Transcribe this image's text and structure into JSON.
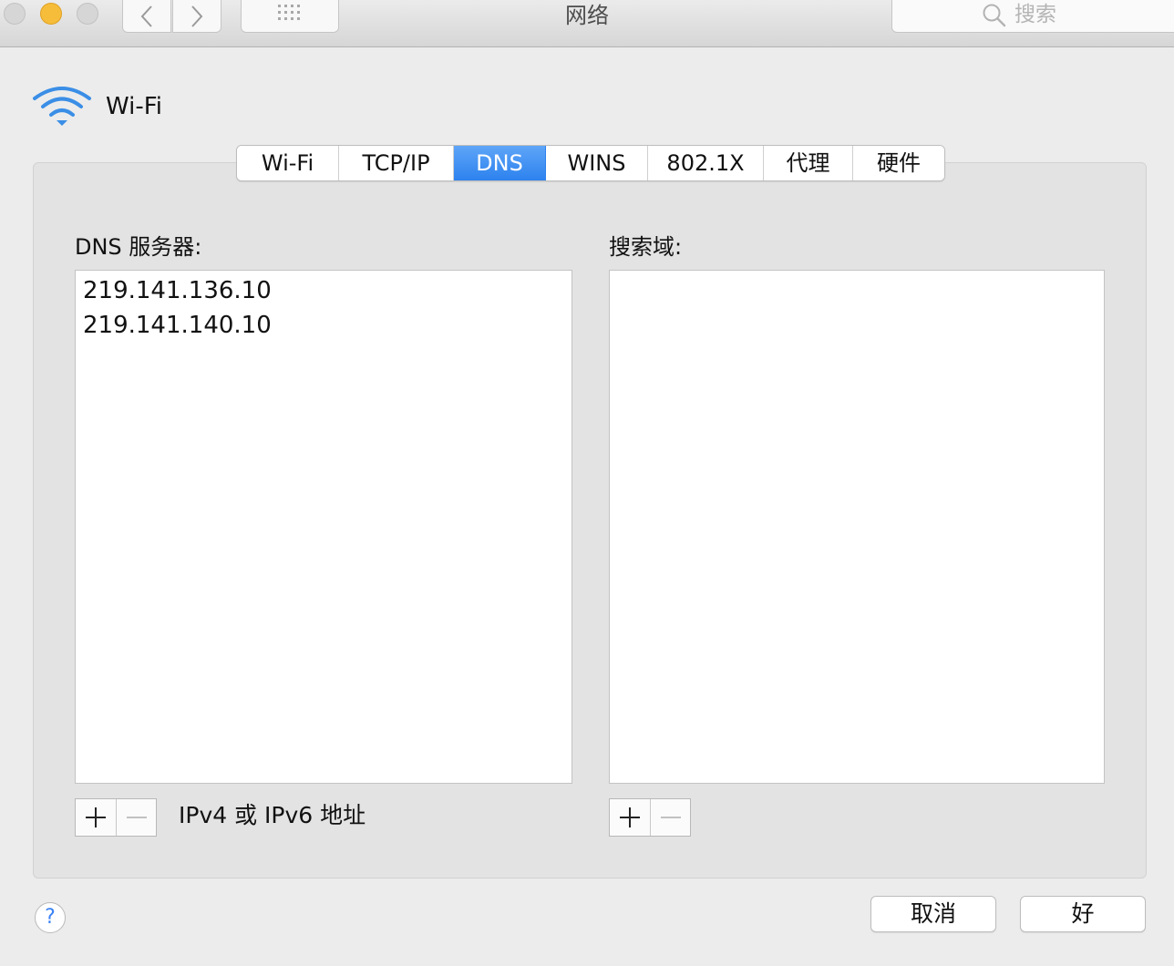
{
  "window": {
    "title": "网络",
    "search_placeholder": "搜索"
  },
  "header": {
    "service_name": "Wi-Fi"
  },
  "tabs": [
    {
      "label": "Wi-Fi",
      "active": false
    },
    {
      "label": "TCP/IP",
      "active": false
    },
    {
      "label": "DNS",
      "active": true
    },
    {
      "label": "WINS",
      "active": false
    },
    {
      "label": "802.1X",
      "active": false
    },
    {
      "label": "代理",
      "active": false
    },
    {
      "label": "硬件",
      "active": false
    }
  ],
  "dns": {
    "label": "DNS 服务器:",
    "servers": [
      "219.141.136.10",
      "219.141.140.10"
    ],
    "hint": "IPv4 或 IPv6 地址"
  },
  "search_domains": {
    "label": "搜索域:",
    "entries": []
  },
  "footer": {
    "help_label": "?",
    "cancel_label": "取消",
    "ok_label": "好"
  },
  "colors": {
    "accent": "#2d82ee",
    "minimize": "#f6bd3b",
    "wifi_icon": "#3a8ee6"
  },
  "icons": {
    "back": "chevron-left-icon",
    "forward": "chevron-right-icon",
    "show_all": "grid-icon",
    "search": "magnifier-icon",
    "service": "wifi-icon",
    "add": "plus-icon",
    "remove": "minus-icon"
  }
}
